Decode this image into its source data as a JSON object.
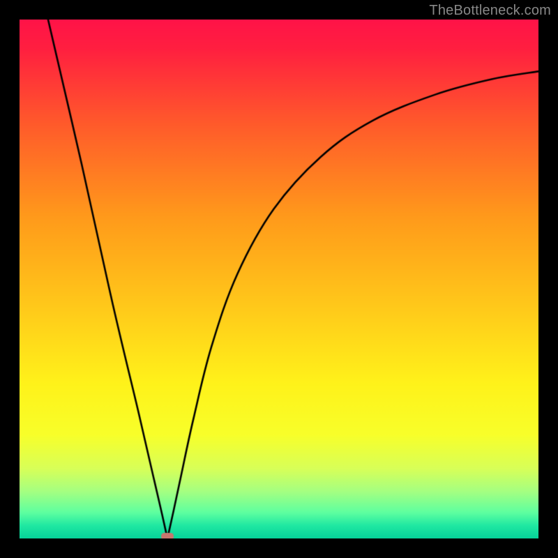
{
  "watermark_text": "TheBottleneck.com",
  "colors": {
    "frame": "#000000",
    "watermark": "#888888",
    "curve": "#000000",
    "marker_fill": "#c8766e",
    "gradient_stops": [
      {
        "pos": 0.0,
        "color": "#ff1348"
      },
      {
        "pos": 0.055,
        "color": "#ff1f40"
      },
      {
        "pos": 0.2,
        "color": "#ff5a2b"
      },
      {
        "pos": 0.38,
        "color": "#ff9a1b"
      },
      {
        "pos": 0.55,
        "color": "#ffc81a"
      },
      {
        "pos": 0.7,
        "color": "#fff21a"
      },
      {
        "pos": 0.8,
        "color": "#f8ff2a"
      },
      {
        "pos": 0.865,
        "color": "#d8ff58"
      },
      {
        "pos": 0.91,
        "color": "#a4ff82"
      },
      {
        "pos": 0.95,
        "color": "#5effa0"
      },
      {
        "pos": 0.975,
        "color": "#20e8a2"
      },
      {
        "pos": 1.0,
        "color": "#06d39a"
      }
    ]
  },
  "chart_data": {
    "type": "line",
    "title": "",
    "xlabel": "",
    "ylabel": "",
    "x_range": [
      0,
      1
    ],
    "y_range": [
      0,
      1
    ],
    "marker": {
      "x": 0.285,
      "y": 0.0
    },
    "left_curve": {
      "desc": "Near-linear descent from top-left frame down to minimum",
      "points": [
        {
          "x": 0.055,
          "y": 1.0
        },
        {
          "x": 0.12,
          "y": 0.72
        },
        {
          "x": 0.18,
          "y": 0.45
        },
        {
          "x": 0.23,
          "y": 0.24
        },
        {
          "x": 0.26,
          "y": 0.11
        },
        {
          "x": 0.275,
          "y": 0.045
        },
        {
          "x": 0.285,
          "y": 0.0
        }
      ]
    },
    "right_curve": {
      "desc": "Rise from minimum, decelerating toward right edge",
      "points": [
        {
          "x": 0.285,
          "y": 0.0
        },
        {
          "x": 0.295,
          "y": 0.045
        },
        {
          "x": 0.31,
          "y": 0.115
        },
        {
          "x": 0.335,
          "y": 0.23
        },
        {
          "x": 0.37,
          "y": 0.37
        },
        {
          "x": 0.42,
          "y": 0.51
        },
        {
          "x": 0.49,
          "y": 0.635
        },
        {
          "x": 0.58,
          "y": 0.735
        },
        {
          "x": 0.68,
          "y": 0.805
        },
        {
          "x": 0.8,
          "y": 0.855
        },
        {
          "x": 0.91,
          "y": 0.885
        },
        {
          "x": 1.0,
          "y": 0.9
        }
      ]
    }
  }
}
